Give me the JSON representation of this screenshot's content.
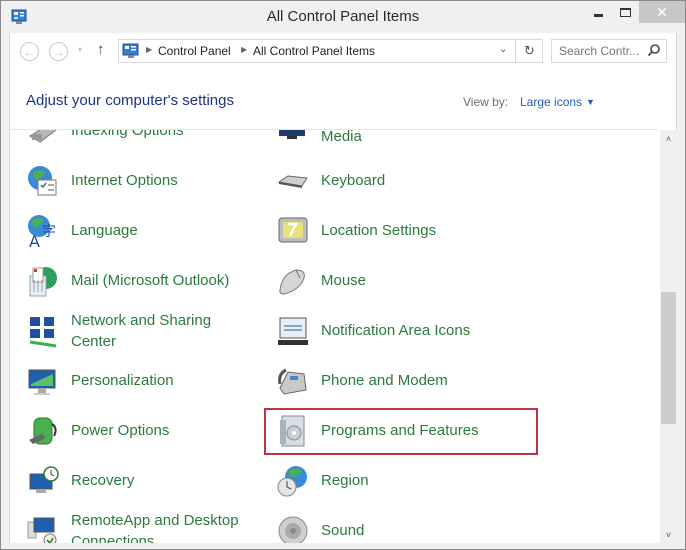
{
  "window": {
    "title": "All Control Panel Items",
    "app_icon": "control-panel-icon",
    "controls": {
      "minimize": "minimize",
      "maximize": "maximize",
      "close": "✕"
    }
  },
  "navbar": {
    "back": "←",
    "forward": "→",
    "recent": "▾",
    "up": "↑",
    "breadcrumb": [
      "Control Panel",
      "All Control Panel Items"
    ],
    "dropdown": "⌄",
    "refresh": "↻",
    "search_placeholder": "Search Contr..."
  },
  "header": {
    "title": "Adjust your computer's settings",
    "view_by_label": "View by:",
    "view_by_value": "Large icons",
    "view_by_arrow": "▼"
  },
  "items": {
    "left": [
      {
        "label": "Indexing Options",
        "icon": "indexing-icon"
      },
      {
        "label": "Internet Options",
        "icon": "internet-options-icon"
      },
      {
        "label": "Language",
        "icon": "language-icon"
      },
      {
        "label": "Mail (Microsoft Outlook)",
        "icon": "mail-icon"
      },
      {
        "label": "Network and Sharing",
        "label2": "Center",
        "icon": "network-icon"
      },
      {
        "label": "Personalization",
        "icon": "personalization-icon"
      },
      {
        "label": "Power Options",
        "icon": "power-icon"
      },
      {
        "label": "Recovery",
        "icon": "recovery-icon"
      },
      {
        "label": "RemoteApp and Desktop",
        "label2": "Connections",
        "icon": "remoteapp-icon"
      }
    ],
    "right": [
      {
        "label": "Media",
        "icon": "media-icon"
      },
      {
        "label": "Keyboard",
        "icon": "keyboard-icon"
      },
      {
        "label": "Location Settings",
        "icon": "location-icon"
      },
      {
        "label": "Mouse",
        "icon": "mouse-icon"
      },
      {
        "label": "Notification Area Icons",
        "icon": "notification-icon"
      },
      {
        "label": "Phone and Modem",
        "icon": "phone-icon"
      },
      {
        "label": "Programs and Features",
        "icon": "programs-icon",
        "highlighted": true
      },
      {
        "label": "Region",
        "icon": "region-icon"
      },
      {
        "label": "Sound",
        "icon": "sound-icon"
      }
    ]
  },
  "scrollbar": {
    "up": "˄",
    "down": "˅",
    "position_fraction": 0.45
  },
  "colors": {
    "link_green": "#2b7a3d",
    "heading_blue": "#1e3287",
    "highlight_red": "#c4323f"
  }
}
